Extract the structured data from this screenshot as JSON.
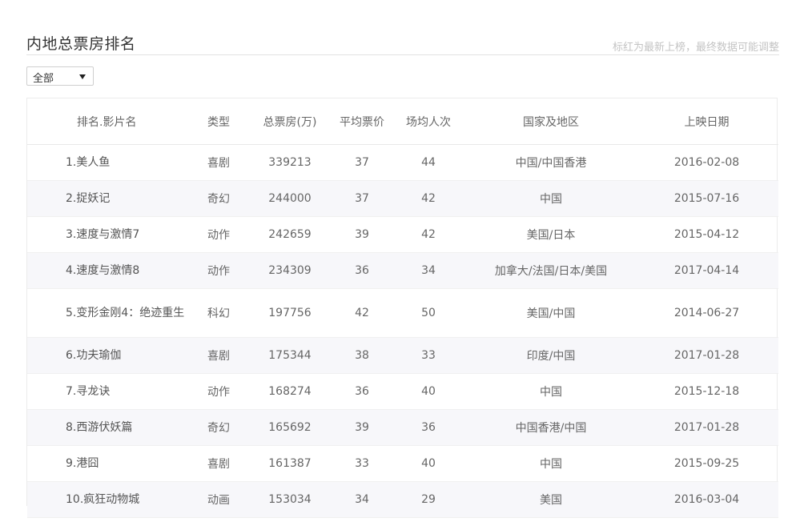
{
  "header": {
    "title": "内地总票房排名",
    "note": "标红为最新上榜，最终数据可能调整"
  },
  "filter": {
    "selected": "全部"
  },
  "table": {
    "columns": [
      "排名.影片名",
      "类型",
      "总票房(万)",
      "平均票价",
      "场均人次",
      "国家及地区",
      "上映日期"
    ],
    "rows": [
      {
        "name": "1.美人鱼",
        "type": "喜剧",
        "gross": "339213",
        "price": "37",
        "avg": "44",
        "country": "中国/中国香港",
        "date": "2016-02-08"
      },
      {
        "name": "2.捉妖记",
        "type": "奇幻",
        "gross": "244000",
        "price": "37",
        "avg": "42",
        "country": "中国",
        "date": "2015-07-16"
      },
      {
        "name": "3.速度与激情7",
        "type": "动作",
        "gross": "242659",
        "price": "39",
        "avg": "42",
        "country": "美国/日本",
        "date": "2015-04-12"
      },
      {
        "name": "4.速度与激情8",
        "type": "动作",
        "gross": "234309",
        "price": "36",
        "avg": "34",
        "country": "加拿大/法国/日本/美国",
        "date": "2017-04-14"
      },
      {
        "name": "5.变形金刚4：绝迹重生",
        "type": "科幻",
        "gross": "197756",
        "price": "42",
        "avg": "50",
        "country": "美国/中国",
        "date": "2014-06-27"
      },
      {
        "name": "6.功夫瑜伽",
        "type": "喜剧",
        "gross": "175344",
        "price": "38",
        "avg": "33",
        "country": "印度/中国",
        "date": "2017-01-28"
      },
      {
        "name": "7.寻龙诀",
        "type": "动作",
        "gross": "168274",
        "price": "36",
        "avg": "40",
        "country": "中国",
        "date": "2015-12-18"
      },
      {
        "name": "8.西游伏妖篇",
        "type": "奇幻",
        "gross": "165692",
        "price": "39",
        "avg": "36",
        "country": "中国香港/中国",
        "date": "2017-01-28"
      },
      {
        "name": "9.港囧",
        "type": "喜剧",
        "gross": "161387",
        "price": "33",
        "avg": "40",
        "country": "中国",
        "date": "2015-09-25"
      },
      {
        "name": "10.疯狂动物城",
        "type": "动画",
        "gross": "153034",
        "price": "34",
        "avg": "29",
        "country": "美国",
        "date": "2016-03-04"
      }
    ]
  }
}
